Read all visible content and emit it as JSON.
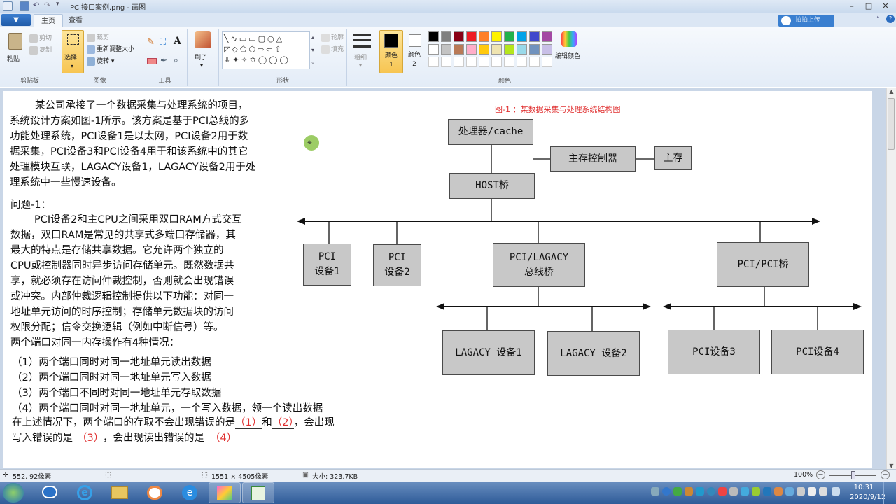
{
  "window": {
    "title": "PCI接口案例.png - 画图"
  },
  "tabs": {
    "file": "▼",
    "home": "主页",
    "view": "查看"
  },
  "share": {
    "label": "拍拍上传"
  },
  "ribbon": {
    "clipboard": {
      "paste": "粘贴",
      "cut": "剪切",
      "copy": "复制",
      "group": "剪贴板"
    },
    "image": {
      "select": "选择",
      "crop": "裁剪",
      "resize": "重新调整大小",
      "rotate": "旋转",
      "group": "图像"
    },
    "tools": {
      "group": "工具"
    },
    "brush": {
      "label": "刷子"
    },
    "shapes": {
      "outline": "轮廓",
      "fill": "填充",
      "group": "形状"
    },
    "size": {
      "label": "粗细"
    },
    "color1": {
      "label": "颜色 1"
    },
    "color2": {
      "label": "颜色 2"
    },
    "colors": {
      "group": "颜色",
      "edit": "编辑颜色",
      "row1": [
        "#000000",
        "#7f7f7f",
        "#880015",
        "#ed1c24",
        "#ff7f27",
        "#fff200",
        "#22b14c",
        "#00a2e8",
        "#3f48cc",
        "#a349a4"
      ],
      "row2": [
        "#ffffff",
        "#c3c3c3",
        "#b97a57",
        "#ffaec9",
        "#ffc90e",
        "#efe4b0",
        "#b5e61d",
        "#99d9ea",
        "#7092be",
        "#c8bfe7"
      ]
    }
  },
  "doc": {
    "intro": [
      "某公司承接了一个数据采集与处理系统的项目，",
      "系统设计方案如图-1所示。该方案是基于PCI总线的多",
      "功能处理系统，PCI设备1是以太网，PCI设备2用于数",
      "据采集，PCI设备3和PCI设备4用于和该系统中的其它",
      "处理模块互联，LAGACY设备1，LAGACY设备2用于处",
      "理系统中一些慢速设备。"
    ],
    "q_label": "问题-1：",
    "para": [
      "PCI设备2和主CPU之间采用双口RAM方式交互",
      "数据，双口RAM是常见的共享式多端口存储器，其",
      "最大的特点是存储共享数据。它允许两个独立的",
      "CPU或控制器同时异步访问存储单元。既然数据共",
      "享，就必须存在访问仲裁控制，否则就会出现错误",
      "或冲突。内部仲裁逻辑控制提供以下功能：对同一",
      "地址单元访问的时序控制；存储单元数据块的访问",
      "权限分配；信令交换逻辑（例如中断信号）等。",
      "两个端口对同一内存操作有4种情况："
    ],
    "cases": [
      "（1）两个端口同时对同一地址单元读出数据",
      "（2）两个端口同时对同一地址单元写入数据",
      "（3）两个端口不同时对同一地址单元存取数据",
      "（4）两个端口同时对同一地址单元，一个写入数据，领一个读出数据"
    ],
    "ans1": {
      "pre": "在上述情况下，两个端口的存取不会出现错误的是",
      "b1": "（1）",
      "mid": "和",
      "b2": "（2）",
      "post": "，会出现"
    },
    "ans2": {
      "pre": "写入错误的是",
      "b3": "（3）",
      "mid": "，会出现读出错误的是",
      "b4": "（4）"
    }
  },
  "diagram": {
    "title": "图-1 ：某数据采集与处理系统结构图",
    "cpu": "处理器/cache",
    "memctl": "主存控制器",
    "mem": "主存",
    "host": "HOST桥",
    "pci1": [
      "PCI",
      "设备1"
    ],
    "pci2": [
      "PCI",
      "设备2"
    ],
    "lagacy_bridge": [
      "PCI/LAGACY",
      "总线桥"
    ],
    "pcipci": "PCI/PCI桥",
    "lag1": "LAGACY 设备1",
    "lag2": "LAGACY 设备2",
    "pci3": "PCI设备3",
    "pci4": "PCI设备4"
  },
  "statusbar": {
    "cursor": "552, 92像素",
    "dims": "1551 × 4505像素",
    "size": "大小: 323.7KB",
    "zoom": "100%"
  },
  "taskbar": {
    "time": "10:31",
    "date": "2020/9/12"
  }
}
